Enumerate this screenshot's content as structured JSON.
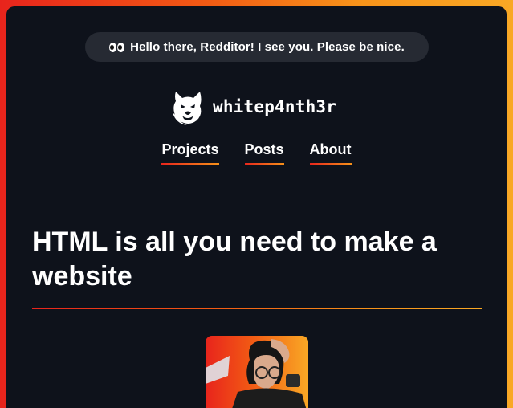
{
  "banner": {
    "icon": "eyes-emoji-icon",
    "text": "Hello there, Redditor! I see you. Please be nice."
  },
  "brand": {
    "logo_icon": "panther-head-icon",
    "name": "whitep4nth3r"
  },
  "nav": {
    "items": [
      {
        "label": "Projects"
      },
      {
        "label": "Posts"
      },
      {
        "label": "About"
      }
    ]
  },
  "post": {
    "title": "HTML is all you need to make a website",
    "avatar_icon": "author-photo"
  },
  "colors": {
    "background": "#0e121b",
    "banner_bg": "#262a33",
    "accent_start": "#e8241c",
    "accent_end": "#f9a825",
    "text": "#ffffff"
  }
}
